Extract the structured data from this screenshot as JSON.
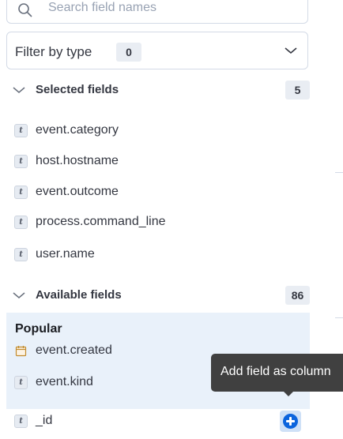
{
  "search": {
    "placeholder": "Search field names",
    "value": ""
  },
  "filter": {
    "label": "Filter by type",
    "count": "0"
  },
  "selected_section": {
    "title": "Selected fields",
    "count": "5",
    "expanded": true,
    "fields": [
      {
        "name": "event.category",
        "type_token": "t"
      },
      {
        "name": "host.hostname",
        "type_token": "t"
      },
      {
        "name": "event.outcome",
        "type_token": "t"
      },
      {
        "name": "process.command_line",
        "type_token": "t"
      },
      {
        "name": "user.name",
        "type_token": "t"
      }
    ]
  },
  "available_section": {
    "title": "Available fields",
    "count": "86",
    "expanded": true,
    "popular": {
      "title": "Popular",
      "fields": [
        {
          "name": "event.created",
          "type": "date",
          "icon": "calendar-icon"
        },
        {
          "name": "event.kind",
          "type_token": "t"
        }
      ]
    },
    "fields": [
      {
        "name": "_id",
        "type_token": "t"
      }
    ]
  },
  "tooltip": {
    "text": "Add field as column"
  },
  "colors": {
    "accent": "#0b64dd",
    "popular_bg": "#e9f1fa",
    "badge_bg": "#e9edf3",
    "tooltip_bg": "#404040",
    "text": "#343741"
  }
}
